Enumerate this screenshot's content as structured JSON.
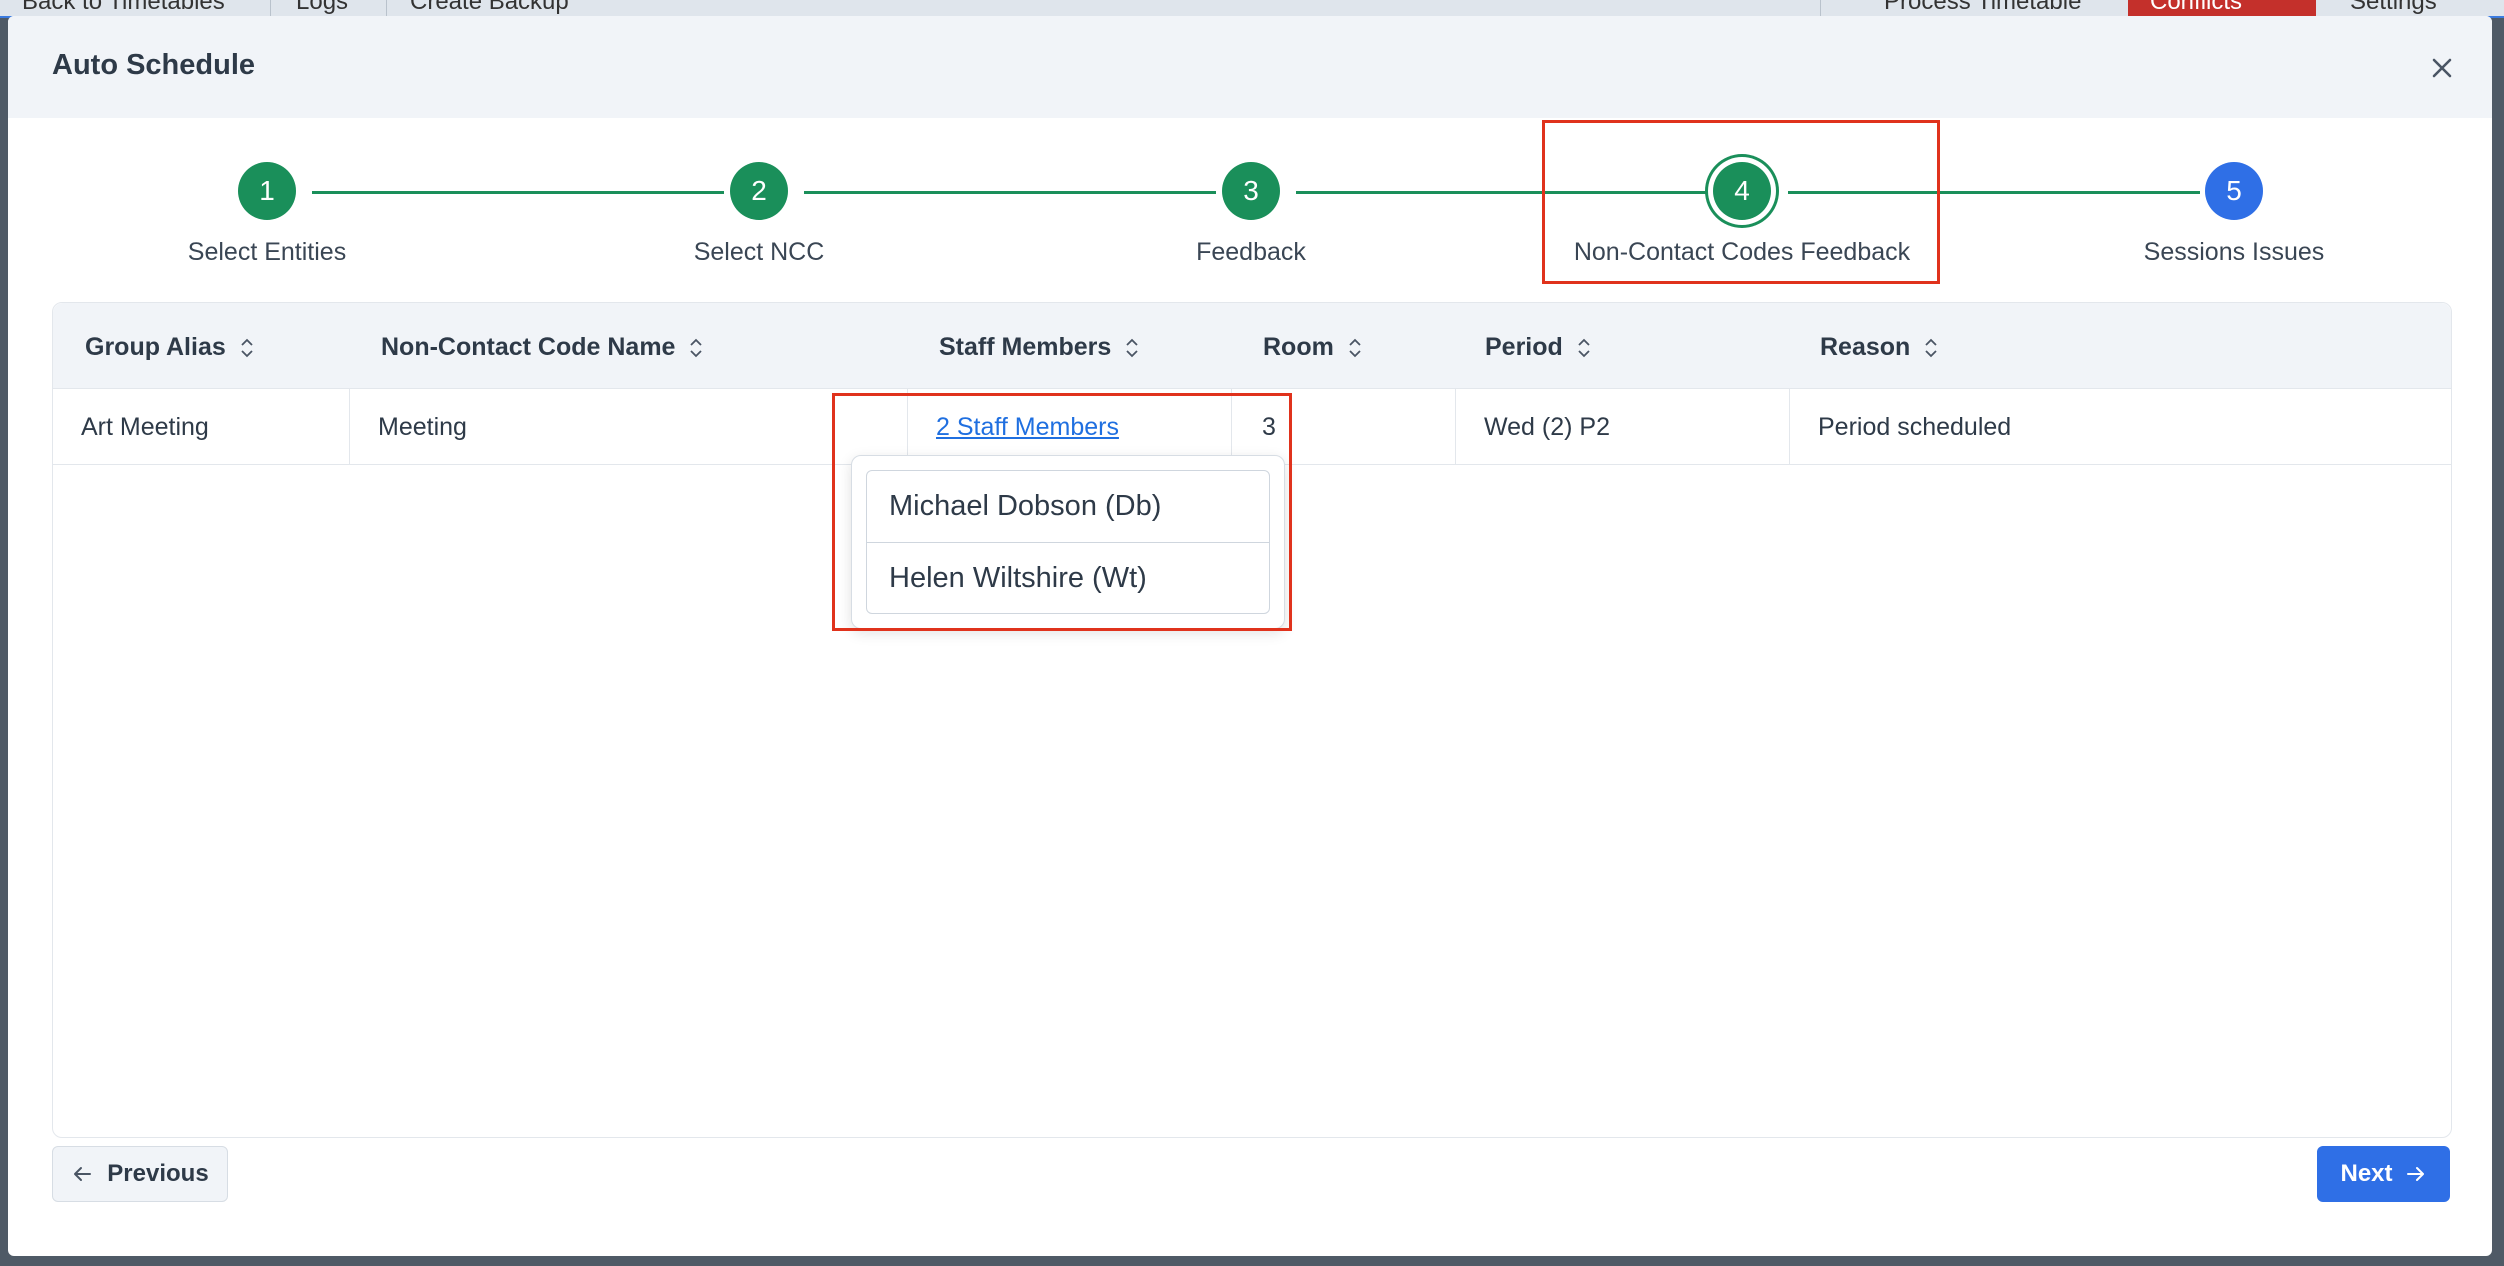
{
  "background_toolbar": {
    "items": [
      "Back to Timetables",
      "Logs",
      "Create Backup",
      "Process Timetable",
      "Conflicts",
      "Settings"
    ]
  },
  "modal": {
    "title": "Auto Schedule"
  },
  "stepper": {
    "steps": [
      {
        "number": "1",
        "label": "Select Entities",
        "state": "complete"
      },
      {
        "number": "2",
        "label": "Select NCC",
        "state": "complete"
      },
      {
        "number": "3",
        "label": "Feedback",
        "state": "complete"
      },
      {
        "number": "4",
        "label": "Non-Contact Codes Feedback",
        "state": "active"
      },
      {
        "number": "5",
        "label": "Sessions Issues",
        "state": "pending"
      }
    ]
  },
  "table": {
    "columns": [
      "Group Alias",
      "Non-Contact Code Name",
      "Staff Members",
      "Room",
      "Period",
      "Reason"
    ],
    "rows": [
      {
        "group_alias": "Art Meeting",
        "ncc_name": "Meeting",
        "staff_members": "2 Staff Members",
        "room": "3",
        "period": "Wed (2) P2",
        "reason": "Period scheduled"
      }
    ]
  },
  "staff_popover": {
    "items": [
      "Michael Dobson (Db)",
      "Helen Wiltshire (Wt)"
    ]
  },
  "footer": {
    "previous_label": "Previous",
    "next_label": "Next"
  },
  "colors": {
    "complete": "#1a8f5a",
    "pending": "#2f6fe6",
    "highlight": "#e0321c",
    "link": "#1f6fe0"
  }
}
